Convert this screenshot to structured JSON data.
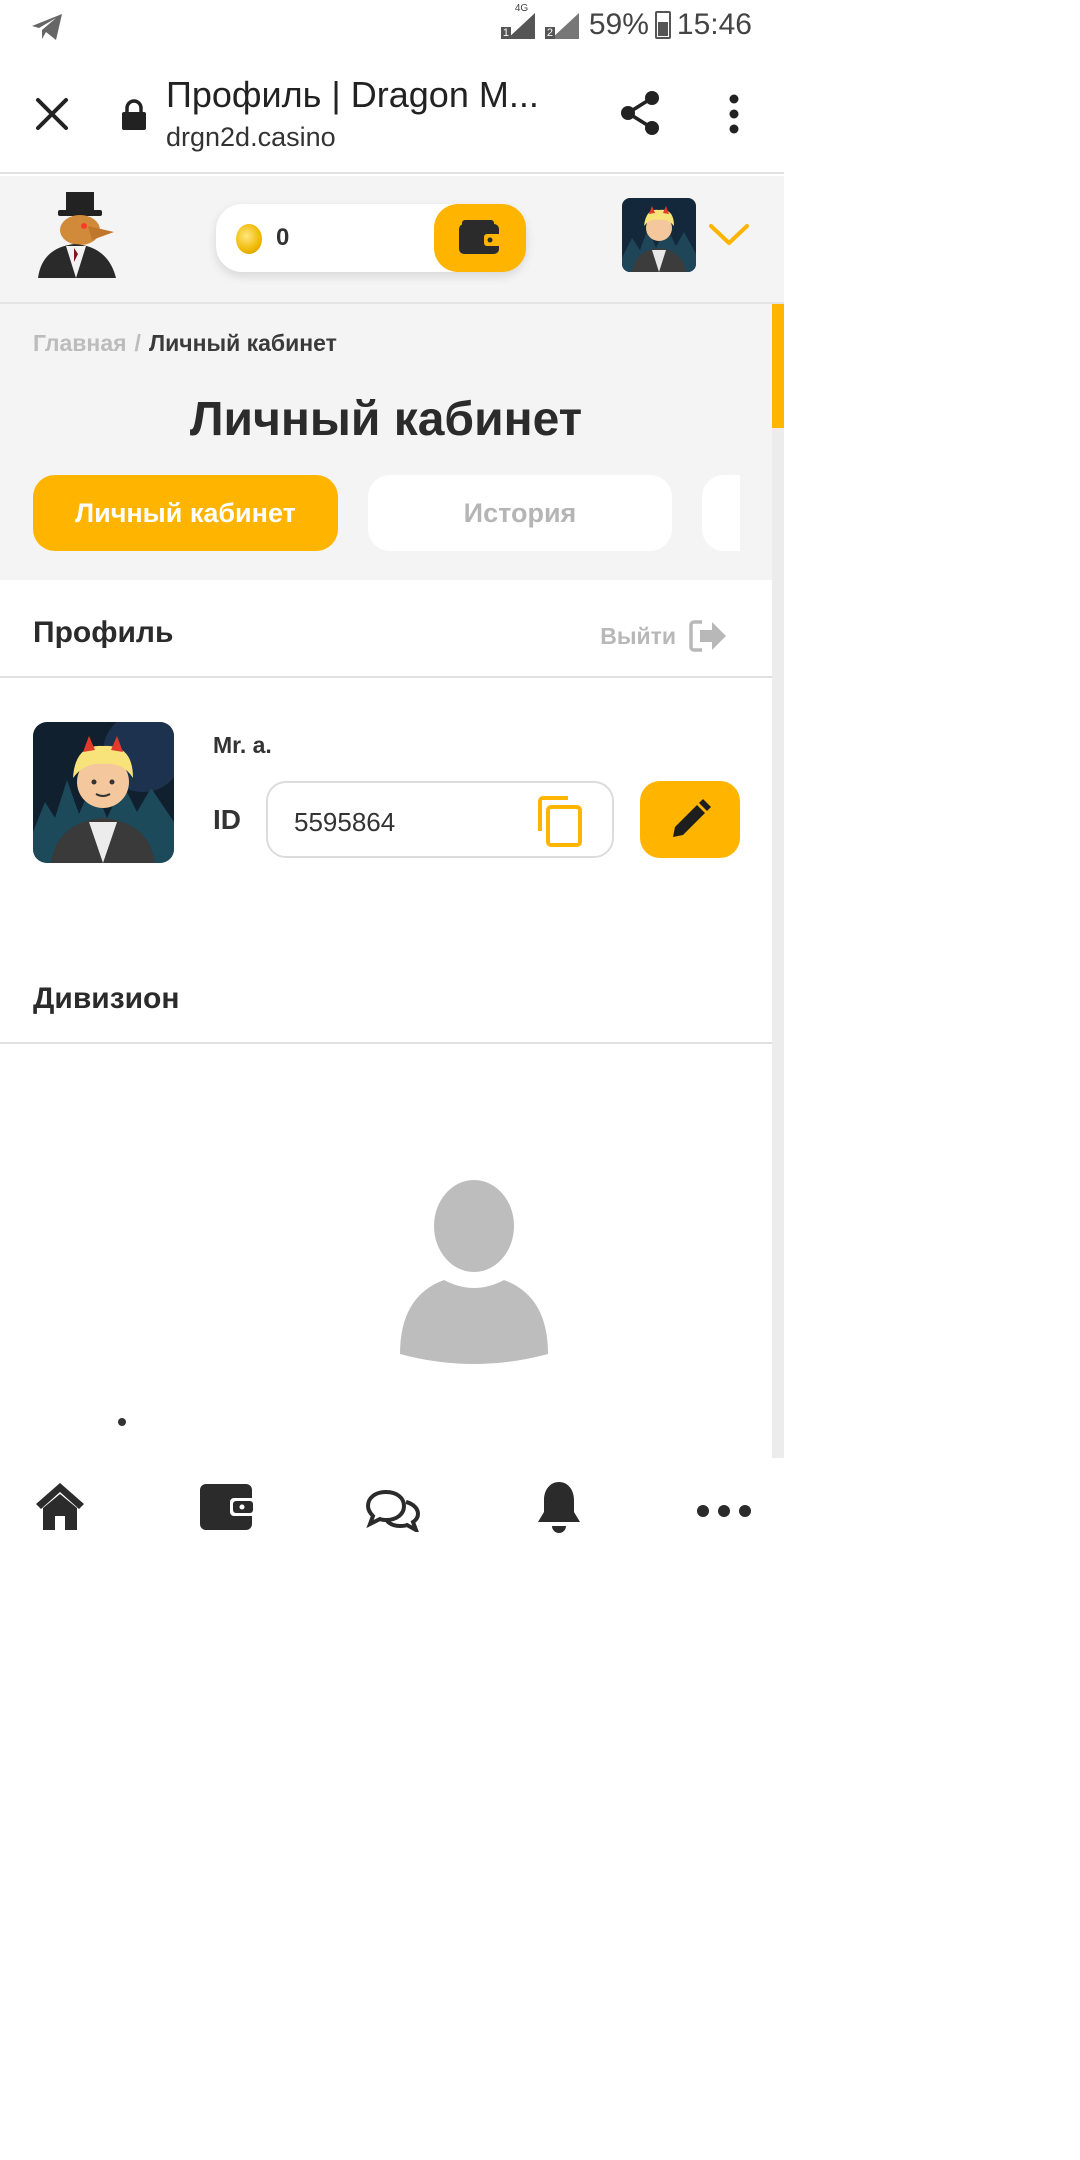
{
  "status_bar": {
    "network_1": "4G",
    "sim_1": "1",
    "sim_2": "2",
    "battery": "59%",
    "time": "15:46"
  },
  "browser": {
    "title": "Профиль | Dragon M...",
    "url": "drgn2d.casino"
  },
  "header": {
    "balance": "0"
  },
  "breadcrumb": {
    "home": "Главная",
    "separator": "/",
    "current": "Личный кабинет"
  },
  "page": {
    "title": "Личный кабинет"
  },
  "tabs": [
    {
      "label": "Личный кабинет",
      "active": true
    },
    {
      "label": "История",
      "active": false
    }
  ],
  "profile": {
    "section_label": "Профиль",
    "logout_label": "Выйти",
    "username": "Mr. a.",
    "id_label": "ID",
    "id_value": "5595864"
  },
  "division": {
    "section_label": "Дивизион"
  },
  "colors": {
    "accent": "#ffb400",
    "muted_text": "#b5b5b5",
    "background_gray": "#f4f4f4"
  },
  "icons": {
    "bottom_nav": [
      "home-icon",
      "wallet-icon",
      "chat-icon",
      "bell-icon",
      "more-icon"
    ]
  }
}
